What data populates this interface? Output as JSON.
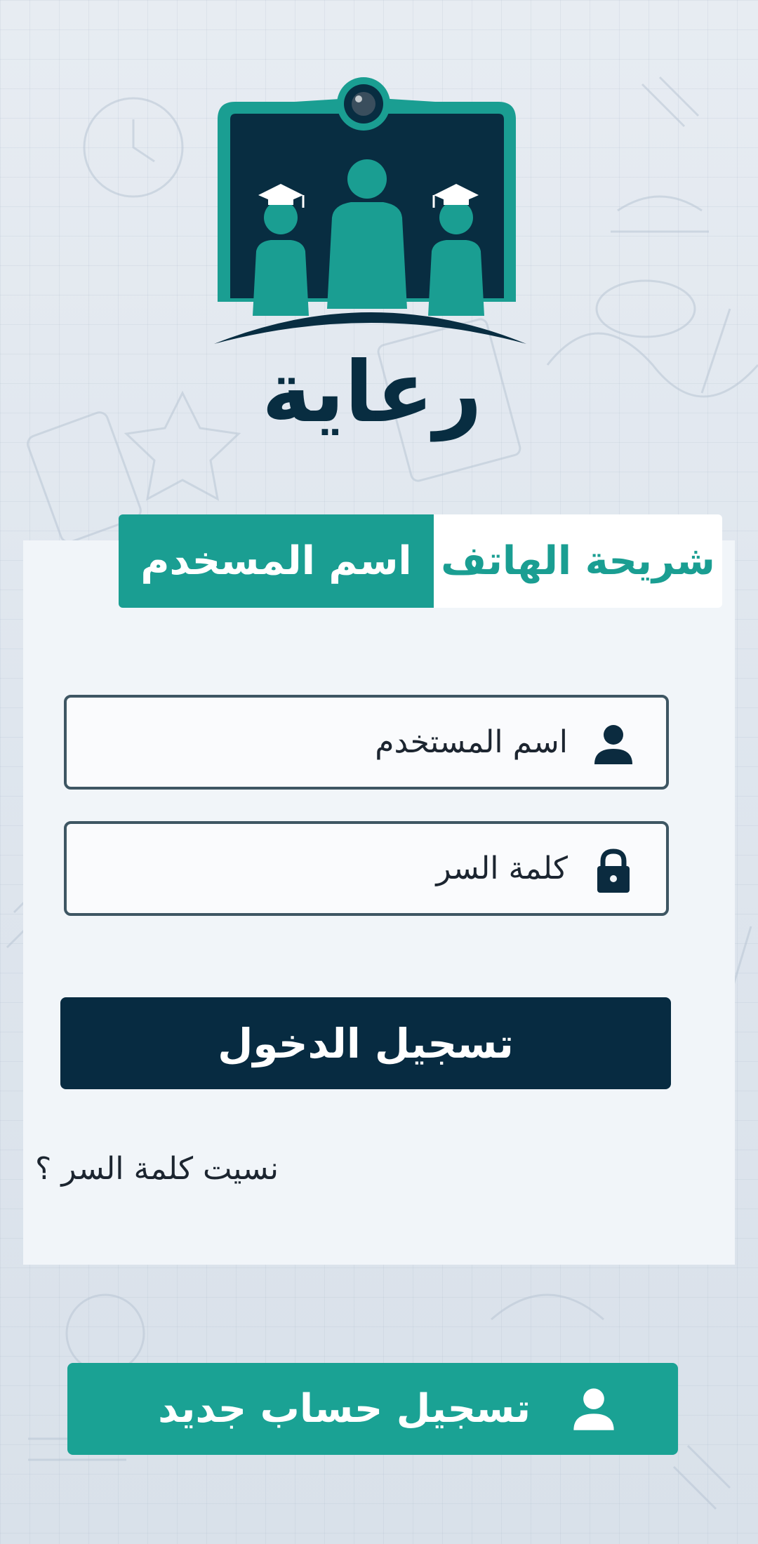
{
  "app": {
    "name": "رعاية"
  },
  "tabs": [
    {
      "label": "شريحة الهاتف",
      "active": false
    },
    {
      "label": "اسم المسخدم",
      "active": true
    }
  ],
  "form": {
    "username_placeholder": "اسم المستخدم",
    "password_placeholder": "كلمة السر",
    "login_label": "تسجيل الدخول",
    "forgot_label": "نسيت كلمة السر ؟"
  },
  "register": {
    "label": "تسجيل حساب جديد"
  },
  "icons": {
    "username": "user-icon",
    "password": "lock-icon",
    "register": "user-icon"
  },
  "colors": {
    "primary_teal": "#1a9e92",
    "dark_navy": "#072b41",
    "card_background": "#f1f5f9"
  }
}
